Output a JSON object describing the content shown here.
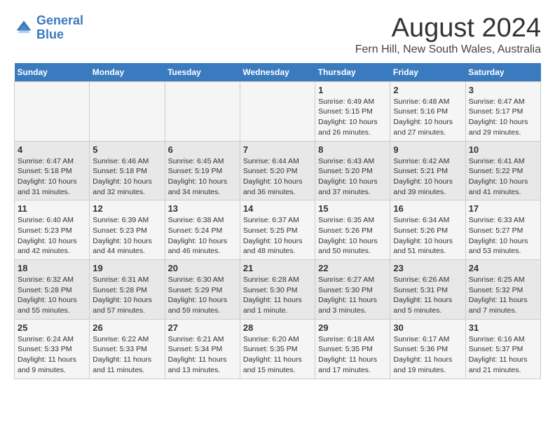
{
  "header": {
    "logo_line1": "General",
    "logo_line2": "Blue",
    "title": "August 2024",
    "subtitle": "Fern Hill, New South Wales, Australia"
  },
  "calendar": {
    "headers": [
      "Sunday",
      "Monday",
      "Tuesday",
      "Wednesday",
      "Thursday",
      "Friday",
      "Saturday"
    ],
    "weeks": [
      [
        {
          "day": "",
          "info": ""
        },
        {
          "day": "",
          "info": ""
        },
        {
          "day": "",
          "info": ""
        },
        {
          "day": "",
          "info": ""
        },
        {
          "day": "1",
          "info": "Sunrise: 6:49 AM\nSunset: 5:15 PM\nDaylight: 10 hours and 26 minutes."
        },
        {
          "day": "2",
          "info": "Sunrise: 6:48 AM\nSunset: 5:16 PM\nDaylight: 10 hours and 27 minutes."
        },
        {
          "day": "3",
          "info": "Sunrise: 6:47 AM\nSunset: 5:17 PM\nDaylight: 10 hours and 29 minutes."
        }
      ],
      [
        {
          "day": "4",
          "info": "Sunrise: 6:47 AM\nSunset: 5:18 PM\nDaylight: 10 hours and 31 minutes."
        },
        {
          "day": "5",
          "info": "Sunrise: 6:46 AM\nSunset: 5:18 PM\nDaylight: 10 hours and 32 minutes."
        },
        {
          "day": "6",
          "info": "Sunrise: 6:45 AM\nSunset: 5:19 PM\nDaylight: 10 hours and 34 minutes."
        },
        {
          "day": "7",
          "info": "Sunrise: 6:44 AM\nSunset: 5:20 PM\nDaylight: 10 hours and 36 minutes."
        },
        {
          "day": "8",
          "info": "Sunrise: 6:43 AM\nSunset: 5:20 PM\nDaylight: 10 hours and 37 minutes."
        },
        {
          "day": "9",
          "info": "Sunrise: 6:42 AM\nSunset: 5:21 PM\nDaylight: 10 hours and 39 minutes."
        },
        {
          "day": "10",
          "info": "Sunrise: 6:41 AM\nSunset: 5:22 PM\nDaylight: 10 hours and 41 minutes."
        }
      ],
      [
        {
          "day": "11",
          "info": "Sunrise: 6:40 AM\nSunset: 5:23 PM\nDaylight: 10 hours and 42 minutes."
        },
        {
          "day": "12",
          "info": "Sunrise: 6:39 AM\nSunset: 5:23 PM\nDaylight: 10 hours and 44 minutes."
        },
        {
          "day": "13",
          "info": "Sunrise: 6:38 AM\nSunset: 5:24 PM\nDaylight: 10 hours and 46 minutes."
        },
        {
          "day": "14",
          "info": "Sunrise: 6:37 AM\nSunset: 5:25 PM\nDaylight: 10 hours and 48 minutes."
        },
        {
          "day": "15",
          "info": "Sunrise: 6:35 AM\nSunset: 5:26 PM\nDaylight: 10 hours and 50 minutes."
        },
        {
          "day": "16",
          "info": "Sunrise: 6:34 AM\nSunset: 5:26 PM\nDaylight: 10 hours and 51 minutes."
        },
        {
          "day": "17",
          "info": "Sunrise: 6:33 AM\nSunset: 5:27 PM\nDaylight: 10 hours and 53 minutes."
        }
      ],
      [
        {
          "day": "18",
          "info": "Sunrise: 6:32 AM\nSunset: 5:28 PM\nDaylight: 10 hours and 55 minutes."
        },
        {
          "day": "19",
          "info": "Sunrise: 6:31 AM\nSunset: 5:28 PM\nDaylight: 10 hours and 57 minutes."
        },
        {
          "day": "20",
          "info": "Sunrise: 6:30 AM\nSunset: 5:29 PM\nDaylight: 10 hours and 59 minutes."
        },
        {
          "day": "21",
          "info": "Sunrise: 6:28 AM\nSunset: 5:30 PM\nDaylight: 11 hours and 1 minute."
        },
        {
          "day": "22",
          "info": "Sunrise: 6:27 AM\nSunset: 5:30 PM\nDaylight: 11 hours and 3 minutes."
        },
        {
          "day": "23",
          "info": "Sunrise: 6:26 AM\nSunset: 5:31 PM\nDaylight: 11 hours and 5 minutes."
        },
        {
          "day": "24",
          "info": "Sunrise: 6:25 AM\nSunset: 5:32 PM\nDaylight: 11 hours and 7 minutes."
        }
      ],
      [
        {
          "day": "25",
          "info": "Sunrise: 6:24 AM\nSunset: 5:33 PM\nDaylight: 11 hours and 9 minutes."
        },
        {
          "day": "26",
          "info": "Sunrise: 6:22 AM\nSunset: 5:33 PM\nDaylight: 11 hours and 11 minutes."
        },
        {
          "day": "27",
          "info": "Sunrise: 6:21 AM\nSunset: 5:34 PM\nDaylight: 11 hours and 13 minutes."
        },
        {
          "day": "28",
          "info": "Sunrise: 6:20 AM\nSunset: 5:35 PM\nDaylight: 11 hours and 15 minutes."
        },
        {
          "day": "29",
          "info": "Sunrise: 6:18 AM\nSunset: 5:35 PM\nDaylight: 11 hours and 17 minutes."
        },
        {
          "day": "30",
          "info": "Sunrise: 6:17 AM\nSunset: 5:36 PM\nDaylight: 11 hours and 19 minutes."
        },
        {
          "day": "31",
          "info": "Sunrise: 6:16 AM\nSunset: 5:37 PM\nDaylight: 11 hours and 21 minutes."
        }
      ]
    ]
  }
}
